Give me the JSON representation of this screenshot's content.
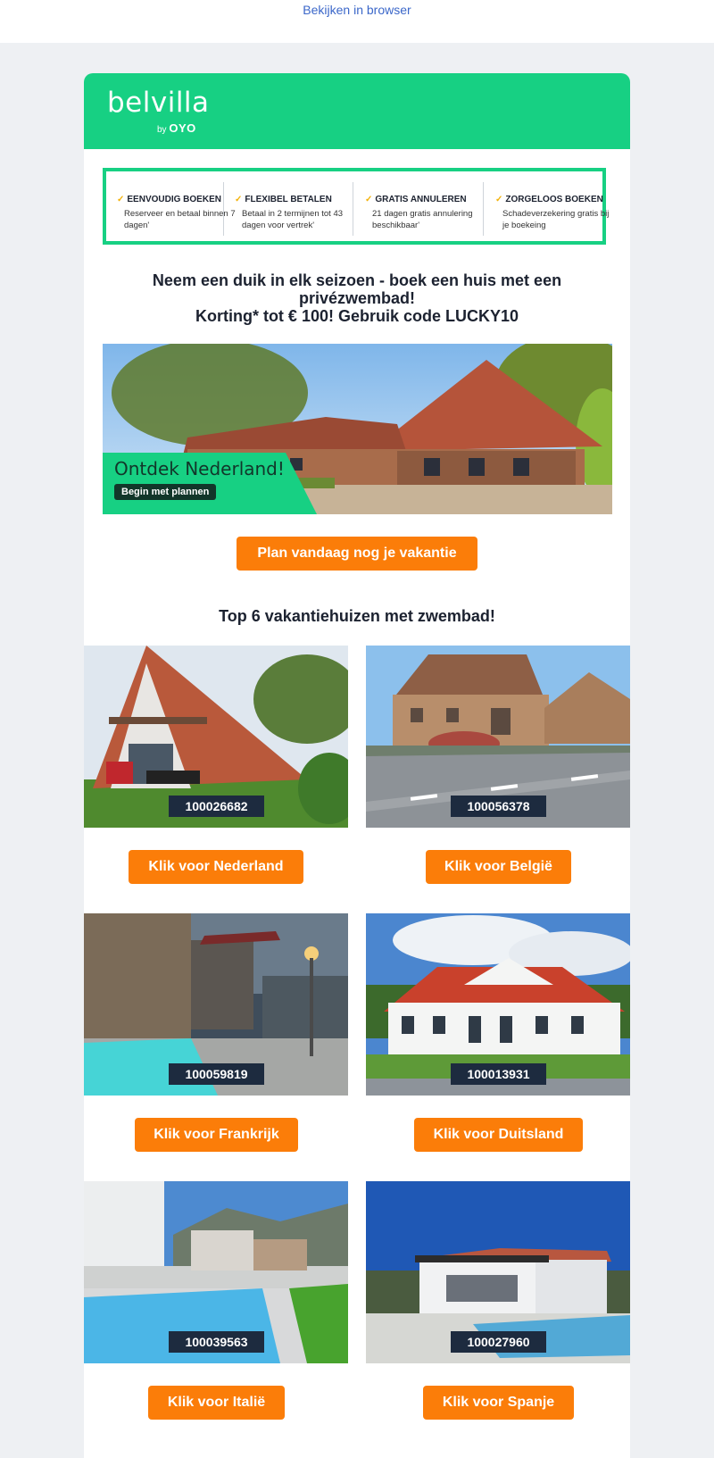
{
  "topbar": {
    "browser_link": "Bekijken in browser"
  },
  "brand": {
    "name": "belvilla",
    "by": "by",
    "parent": "OYO",
    "color": "#17d083"
  },
  "usps": [
    {
      "title": "EENVOUDIG BOEKEN",
      "desc": "Reserveer en betaal binnen 7 dagen'"
    },
    {
      "title": "FLEXIBEL BETALEN",
      "desc": "Betaal in 2 termijnen tot 43 dagen voor vertrek'"
    },
    {
      "title": "GRATIS ANNULEREN",
      "desc": "21 dagen gratis annulering beschikbaar'"
    },
    {
      "title": "ZORGELOOS BOEKEN",
      "desc": "Schadeverzekering gratis bij je boekeing"
    }
  ],
  "headline": {
    "line1": "Neem een duik in elk seizoen - boek een huis met een privézwembad!",
    "line2": "Korting* tot € 100! Gebruik code LUCKY10"
  },
  "hero": {
    "title": "Ontdek Nederland!",
    "cta": "Begin met plannen"
  },
  "main_cta": "Plan vandaag nog je vakantie",
  "section_title": "Top 6 vakantiehuizen met zwembad!",
  "houses": [
    {
      "code": "100026682",
      "cta": "Klik voor Nederland"
    },
    {
      "code": "100056378",
      "cta": "Klik voor België"
    },
    {
      "code": "100059819",
      "cta": "Klik voor Frankrijk"
    },
    {
      "code": "100013931",
      "cta": "Klik voor Duitsland"
    },
    {
      "code": "100039563",
      "cta": "Klik voor Italië"
    },
    {
      "code": "100027960",
      "cta": "Klik voor Spanje"
    }
  ],
  "colors": {
    "accent": "#fb7d09",
    "code_badge": "#1d2b3f"
  }
}
